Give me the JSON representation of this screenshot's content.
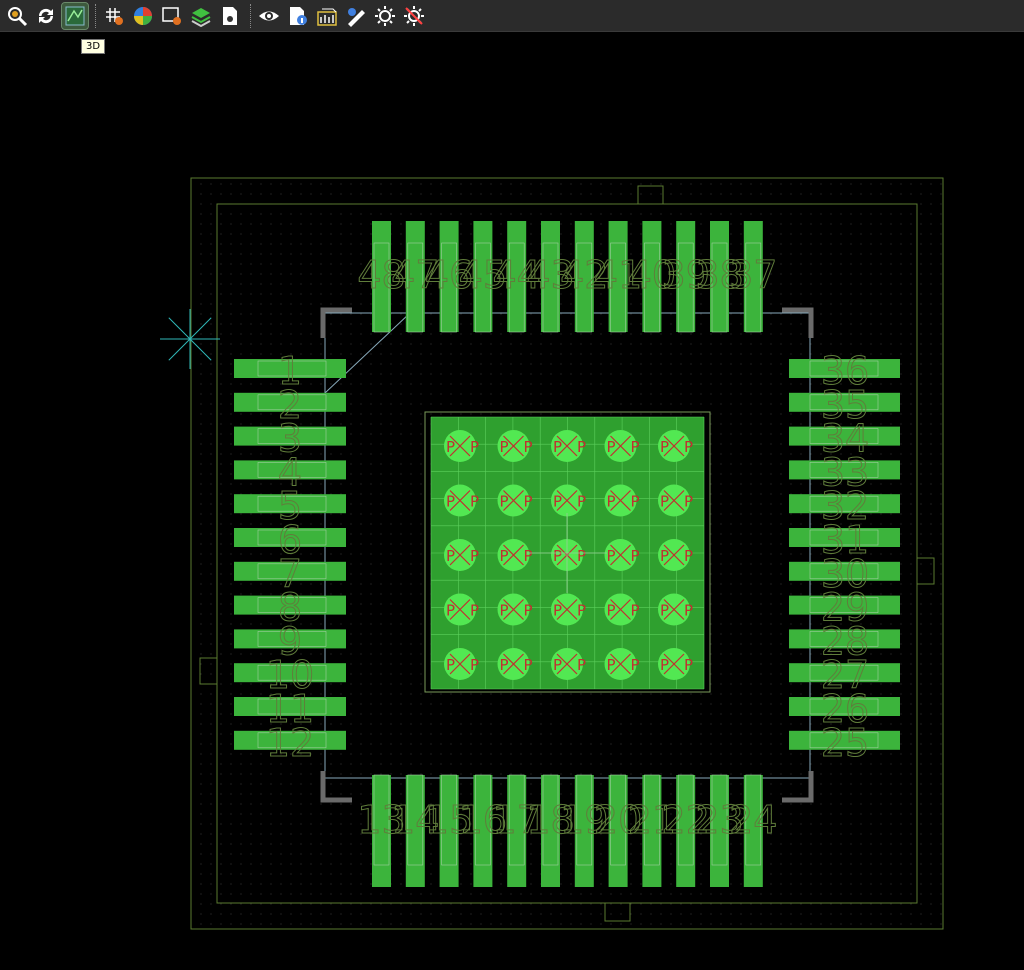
{
  "toolbar": {
    "buttons": [
      {
        "name": "zoom-icon",
        "color": "#e0a020"
      },
      {
        "name": "refresh-icon",
        "color": "#ffffff"
      },
      {
        "name": "3d-view-icon",
        "color": "#40a040",
        "active": true
      },
      {
        "name": "grid-icon",
        "color": "#ffffff"
      },
      {
        "name": "color-wheel-icon",
        "color": "#e08020"
      },
      {
        "name": "window-settings-icon",
        "color": "#ffffff"
      },
      {
        "name": "layers-icon",
        "color": "#40c040"
      },
      {
        "name": "document-settings-icon",
        "color": "#ffffff"
      },
      {
        "name": "eye-icon",
        "color": "#ffffff"
      },
      {
        "name": "info-doc-icon",
        "color": "#4080e0"
      },
      {
        "name": "3d-box-icon",
        "color": "#ffffff"
      },
      {
        "name": "pen-tool-icon",
        "color": "#ffffff"
      },
      {
        "name": "brightness-icon",
        "color": "#ffffff"
      },
      {
        "name": "brightness-off-icon",
        "color": "#ff4040"
      }
    ],
    "tooltip": "3D"
  },
  "footprint": {
    "top_pins": [
      "48",
      "47",
      "46",
      "45",
      "44",
      "43",
      "42",
      "41",
      "40",
      "39",
      "38",
      "37"
    ],
    "bottom_pins": [
      "13",
      "14",
      "15",
      "16",
      "17",
      "18",
      "19",
      "20",
      "21",
      "22",
      "23",
      "24"
    ],
    "left_pins": [
      "1",
      "2",
      "3",
      "4",
      "5",
      "6",
      "7",
      "8",
      "9",
      "10",
      "11",
      "12"
    ],
    "right_pins": [
      "36",
      "35",
      "34",
      "33",
      "32",
      "31",
      "30",
      "29",
      "28",
      "27",
      "26",
      "25"
    ],
    "pad_color": "#3cb43c",
    "via_color": "#52e852",
    "via_label": "P",
    "cross_color": "#c03030",
    "outline_color": "#6a8a3a",
    "origin_color": "#2fb8b8"
  }
}
